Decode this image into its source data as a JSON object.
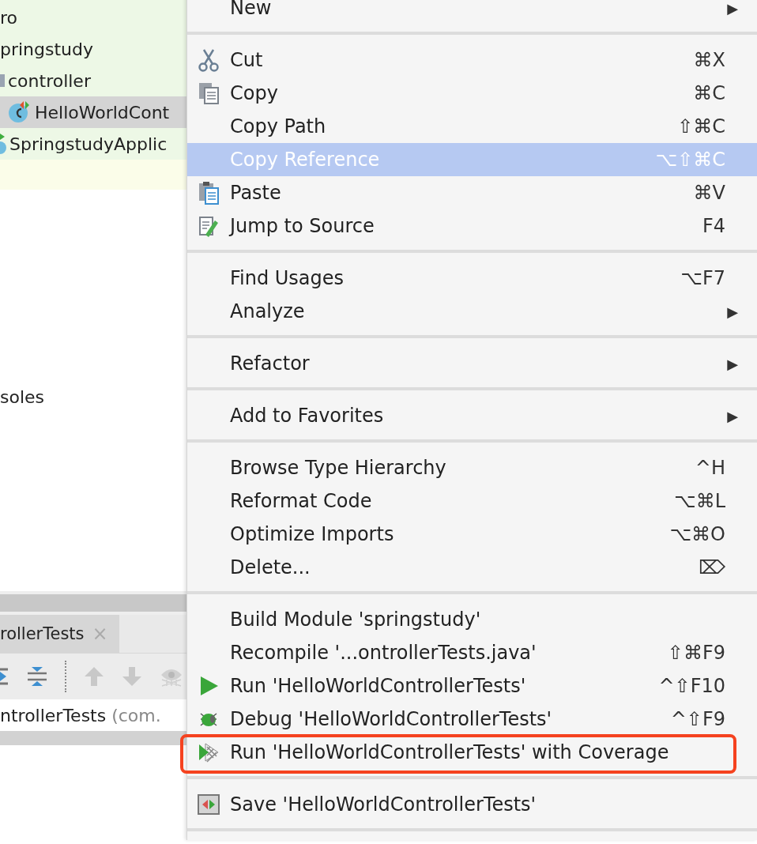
{
  "project_tree": {
    "items": [
      {
        "label": "ro",
        "kind": "plain",
        "selected": false
      },
      {
        "label": "pringstudy",
        "kind": "plain",
        "selected": false
      },
      {
        "label": "controller",
        "kind": "package",
        "selected": false,
        "children": [
          {
            "label": "HelloWorldCont",
            "kind": "test-class",
            "selected": true
          }
        ]
      },
      {
        "label": "SpringstudyApplic",
        "kind": "app-class",
        "selected": false
      }
    ]
  },
  "side_label": "soles",
  "run_panel": {
    "tabs": [
      {
        "label": "rollerTests",
        "close": "×",
        "selected": true
      }
    ],
    "tree_row": {
      "label": "ntrollerTests",
      "package": "(com."
    }
  },
  "context_menu": {
    "items": [
      {
        "kind": "item",
        "label": "New",
        "submenu": "▶",
        "selected": false
      },
      {
        "kind": "separator"
      },
      {
        "kind": "cut",
        "label": "Cut",
        "shortcut": "⌘X",
        "selected": false
      },
      {
        "kind": "copy",
        "label": "Copy",
        "shortcut": "⌘C",
        "selected": false
      },
      {
        "kind": "item",
        "label": "Copy Path",
        "shortcut": "⇧⌘C",
        "selected": false
      },
      {
        "kind": "item",
        "label": "Copy Reference",
        "shortcut": "⌥⇧⌘C",
        "selected": true
      },
      {
        "kind": "paste",
        "label": "Paste",
        "shortcut": "⌘V",
        "selected": false
      },
      {
        "kind": "jump",
        "label": "Jump to Source",
        "shortcut": "F4",
        "selected": false
      },
      {
        "kind": "separator"
      },
      {
        "kind": "item",
        "label": "Find Usages",
        "shortcut": "⌥F7",
        "selected": false
      },
      {
        "kind": "item",
        "label": "Analyze",
        "submenu": "▶",
        "selected": false
      },
      {
        "kind": "separator"
      },
      {
        "kind": "item",
        "label": "Refactor",
        "submenu": "▶",
        "selected": false
      },
      {
        "kind": "separator"
      },
      {
        "kind": "item",
        "label": "Add to Favorites",
        "submenu": "▶",
        "selected": false
      },
      {
        "kind": "separator"
      },
      {
        "kind": "item",
        "label": "Browse Type Hierarchy",
        "shortcut": "^H",
        "selected": false
      },
      {
        "kind": "item",
        "label": "Reformat Code",
        "shortcut": "⌥⌘L",
        "selected": false
      },
      {
        "kind": "item",
        "label": "Optimize Imports",
        "shortcut": "⌥⌘O",
        "selected": false
      },
      {
        "kind": "item",
        "label": "Delete...",
        "shortcut": "⌦",
        "selected": false
      },
      {
        "kind": "separator"
      },
      {
        "kind": "item",
        "label": "Build Module 'springstudy'",
        "selected": false
      },
      {
        "kind": "item",
        "label": "Recompile '...ontrollerTests.java'",
        "shortcut": "⇧⌘F9",
        "selected": false
      },
      {
        "kind": "run",
        "label": "Run 'HelloWorldControllerTests'",
        "shortcut": "^⇧F10",
        "selected": false
      },
      {
        "kind": "debug",
        "label": "Debug 'HelloWorldControllerTests'",
        "shortcut": "^⇧F9",
        "selected": false
      },
      {
        "kind": "coverage",
        "label": "Run 'HelloWorldControllerTests' with Coverage",
        "selected": false,
        "highlighted": true
      },
      {
        "kind": "separator"
      },
      {
        "kind": "save",
        "label": "Save 'HelloWorldControllerTests'",
        "selected": false
      },
      {
        "kind": "separator"
      }
    ]
  }
}
